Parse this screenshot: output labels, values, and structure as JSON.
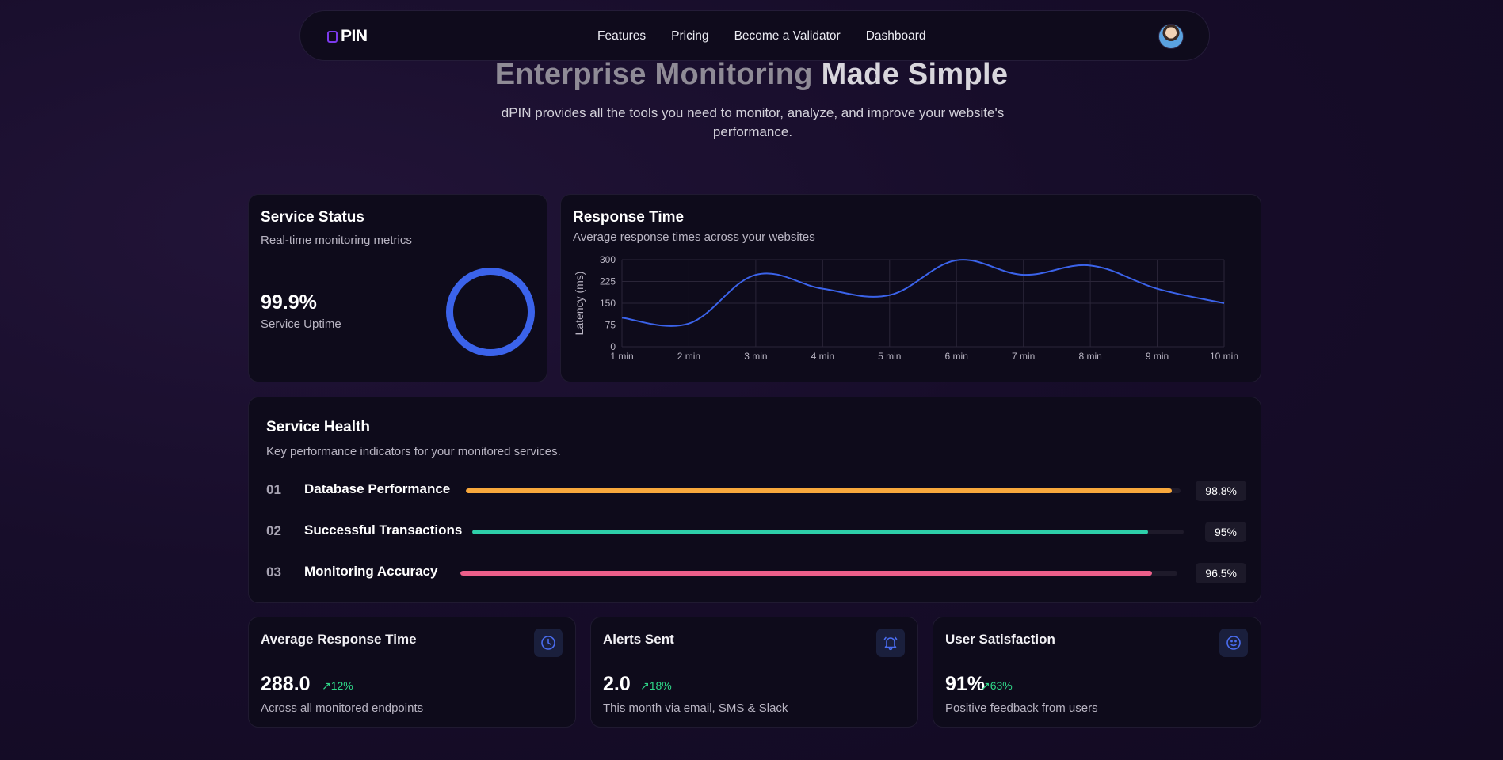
{
  "nav": {
    "logo": "PIN",
    "links": [
      "Features",
      "Pricing",
      "Become a Validator",
      "Dashboard"
    ]
  },
  "hero": {
    "title_part1": "Enterprise Monitoring",
    "title_part2": "Made Simple",
    "subtitle": "dPIN provides all the tools you need to monitor, analyze, and improve your website's performance."
  },
  "status": {
    "title": "Service Status",
    "subtitle": "Real-time monitoring metrics",
    "uptime": "99.9%",
    "uptime_label": "Service Uptime",
    "ring_color": "#3b63ea"
  },
  "response": {
    "title": "Response Time",
    "subtitle": "Average response times across your websites"
  },
  "chart_data": {
    "type": "line",
    "x": [
      "1 min",
      "2 min",
      "3 min",
      "4 min",
      "5 min",
      "6 min",
      "7 min",
      "8 min",
      "9 min",
      "10 min"
    ],
    "series": [
      {
        "values": [
          100,
          80,
          248,
          200,
          178,
          298,
          248,
          280,
          200,
          150
        ]
      }
    ],
    "ylabel": "Latency (ms)",
    "yticks": [
      0,
      75,
      150,
      225,
      300
    ],
    "ylim": [
      0,
      300
    ],
    "grid": true,
    "line_color": "#3b63ea"
  },
  "health": {
    "title": "Service Health",
    "subtitle": "Key performance indicators for your monitored services.",
    "items": [
      {
        "num": "01",
        "name": "Database Performance",
        "value": 98.8,
        "label": "98.8%",
        "color": "#f8a83c"
      },
      {
        "num": "02",
        "name": "Successful Transactions",
        "value": 95,
        "label": "95%",
        "color": "#2ecfaa"
      },
      {
        "num": "03",
        "name": "Monitoring Accuracy",
        "value": 96.5,
        "label": "96.5%",
        "color": "#ec5f8a"
      }
    ]
  },
  "metrics": [
    {
      "title": "Average Response Time",
      "value": "288.0",
      "change": "12%",
      "desc": "Across all monitored endpoints",
      "icon": "clock-icon"
    },
    {
      "title": "Alerts Sent",
      "value": "2.0",
      "change": "18%",
      "desc": "This month via email, SMS & Slack",
      "icon": "bell-icon"
    },
    {
      "title": "User Satisfaction",
      "value": "91%",
      "change": "63%",
      "desc": "Positive feedback from users",
      "icon": "smile-icon"
    }
  ]
}
